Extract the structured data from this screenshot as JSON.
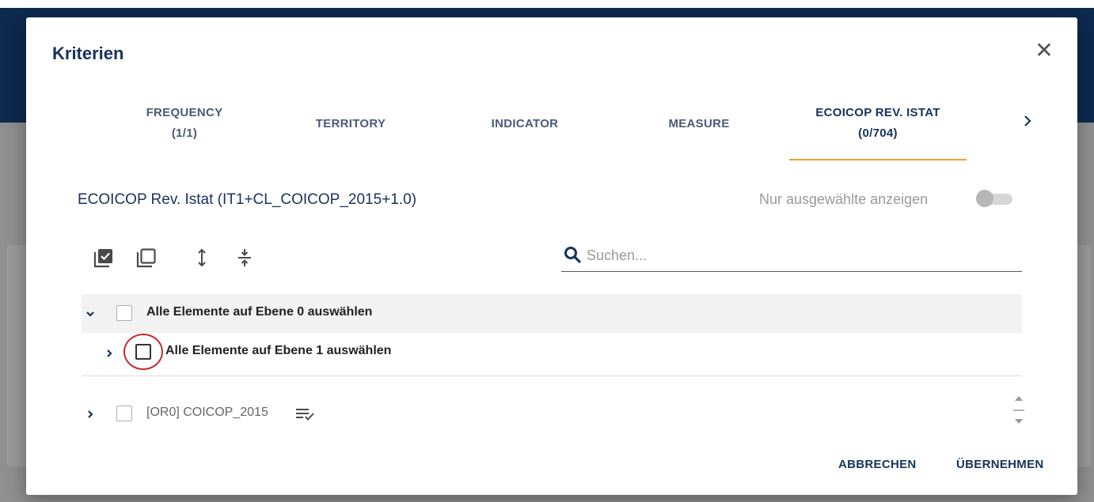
{
  "dialog": {
    "title": "Kriterien",
    "close_icon": "close-icon",
    "tabs": [
      {
        "line1": "FREQUENCY",
        "line2": "(1/1)",
        "active": false
      },
      {
        "line1": "TERRITORY",
        "line2": "",
        "active": false
      },
      {
        "line1": "INDICATOR",
        "line2": "",
        "active": false
      },
      {
        "line1": "MEASURE",
        "line2": "",
        "active": false
      },
      {
        "line1": "ECOICOP REV. ISTAT",
        "line2": "(0/704)",
        "active": true
      }
    ],
    "tab_next_icon": "chevron-right-icon",
    "section_title": "ECOICOP Rev. Istat (IT1+CL_COICOP_2015+1.0)",
    "toggle": {
      "label": "Nur ausgewählte anzeigen",
      "on": false
    },
    "toolbar": {
      "icons": [
        "select-all-icon",
        "deselect-all-icon",
        "expand-all-icon",
        "collapse-all-icon"
      ]
    },
    "search": {
      "placeholder": "Suchen...",
      "value": "",
      "icon": "search-icon"
    },
    "level_rows": [
      {
        "label": "Alle Elemente auf Ebene 0 auswählen",
        "expanded": true,
        "checked": false
      },
      {
        "label": "Alle Elemente auf Ebene 1 auswählen",
        "expanded": false,
        "checked": false,
        "highlighted": true
      }
    ],
    "items": [
      {
        "label": "[OR0] COICOP_2015",
        "expanded": false,
        "checked": false,
        "icon": "select-children-icon"
      }
    ],
    "actions": {
      "cancel": "ABBRECHEN",
      "apply": "ÜBERNEHMEN"
    },
    "colors": {
      "primary": "#17325c",
      "accent": "#f0a22e",
      "highlight": "#c42b2b"
    }
  }
}
